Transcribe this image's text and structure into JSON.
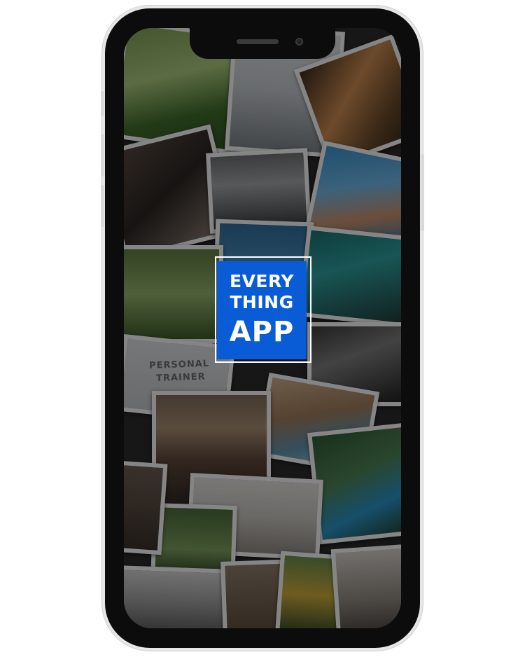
{
  "app": {
    "logo_line1": "EVERY",
    "logo_line2": "THING",
    "logo_line3": "APP",
    "brand_color": "#0a5bd6"
  },
  "collage": {
    "shirt_print_line1": "PERSONAL",
    "shirt_print_line2": "TRAINER"
  },
  "device": {
    "frame_color": "#0c0c0c",
    "bezel_color": "#e7e7e7"
  }
}
